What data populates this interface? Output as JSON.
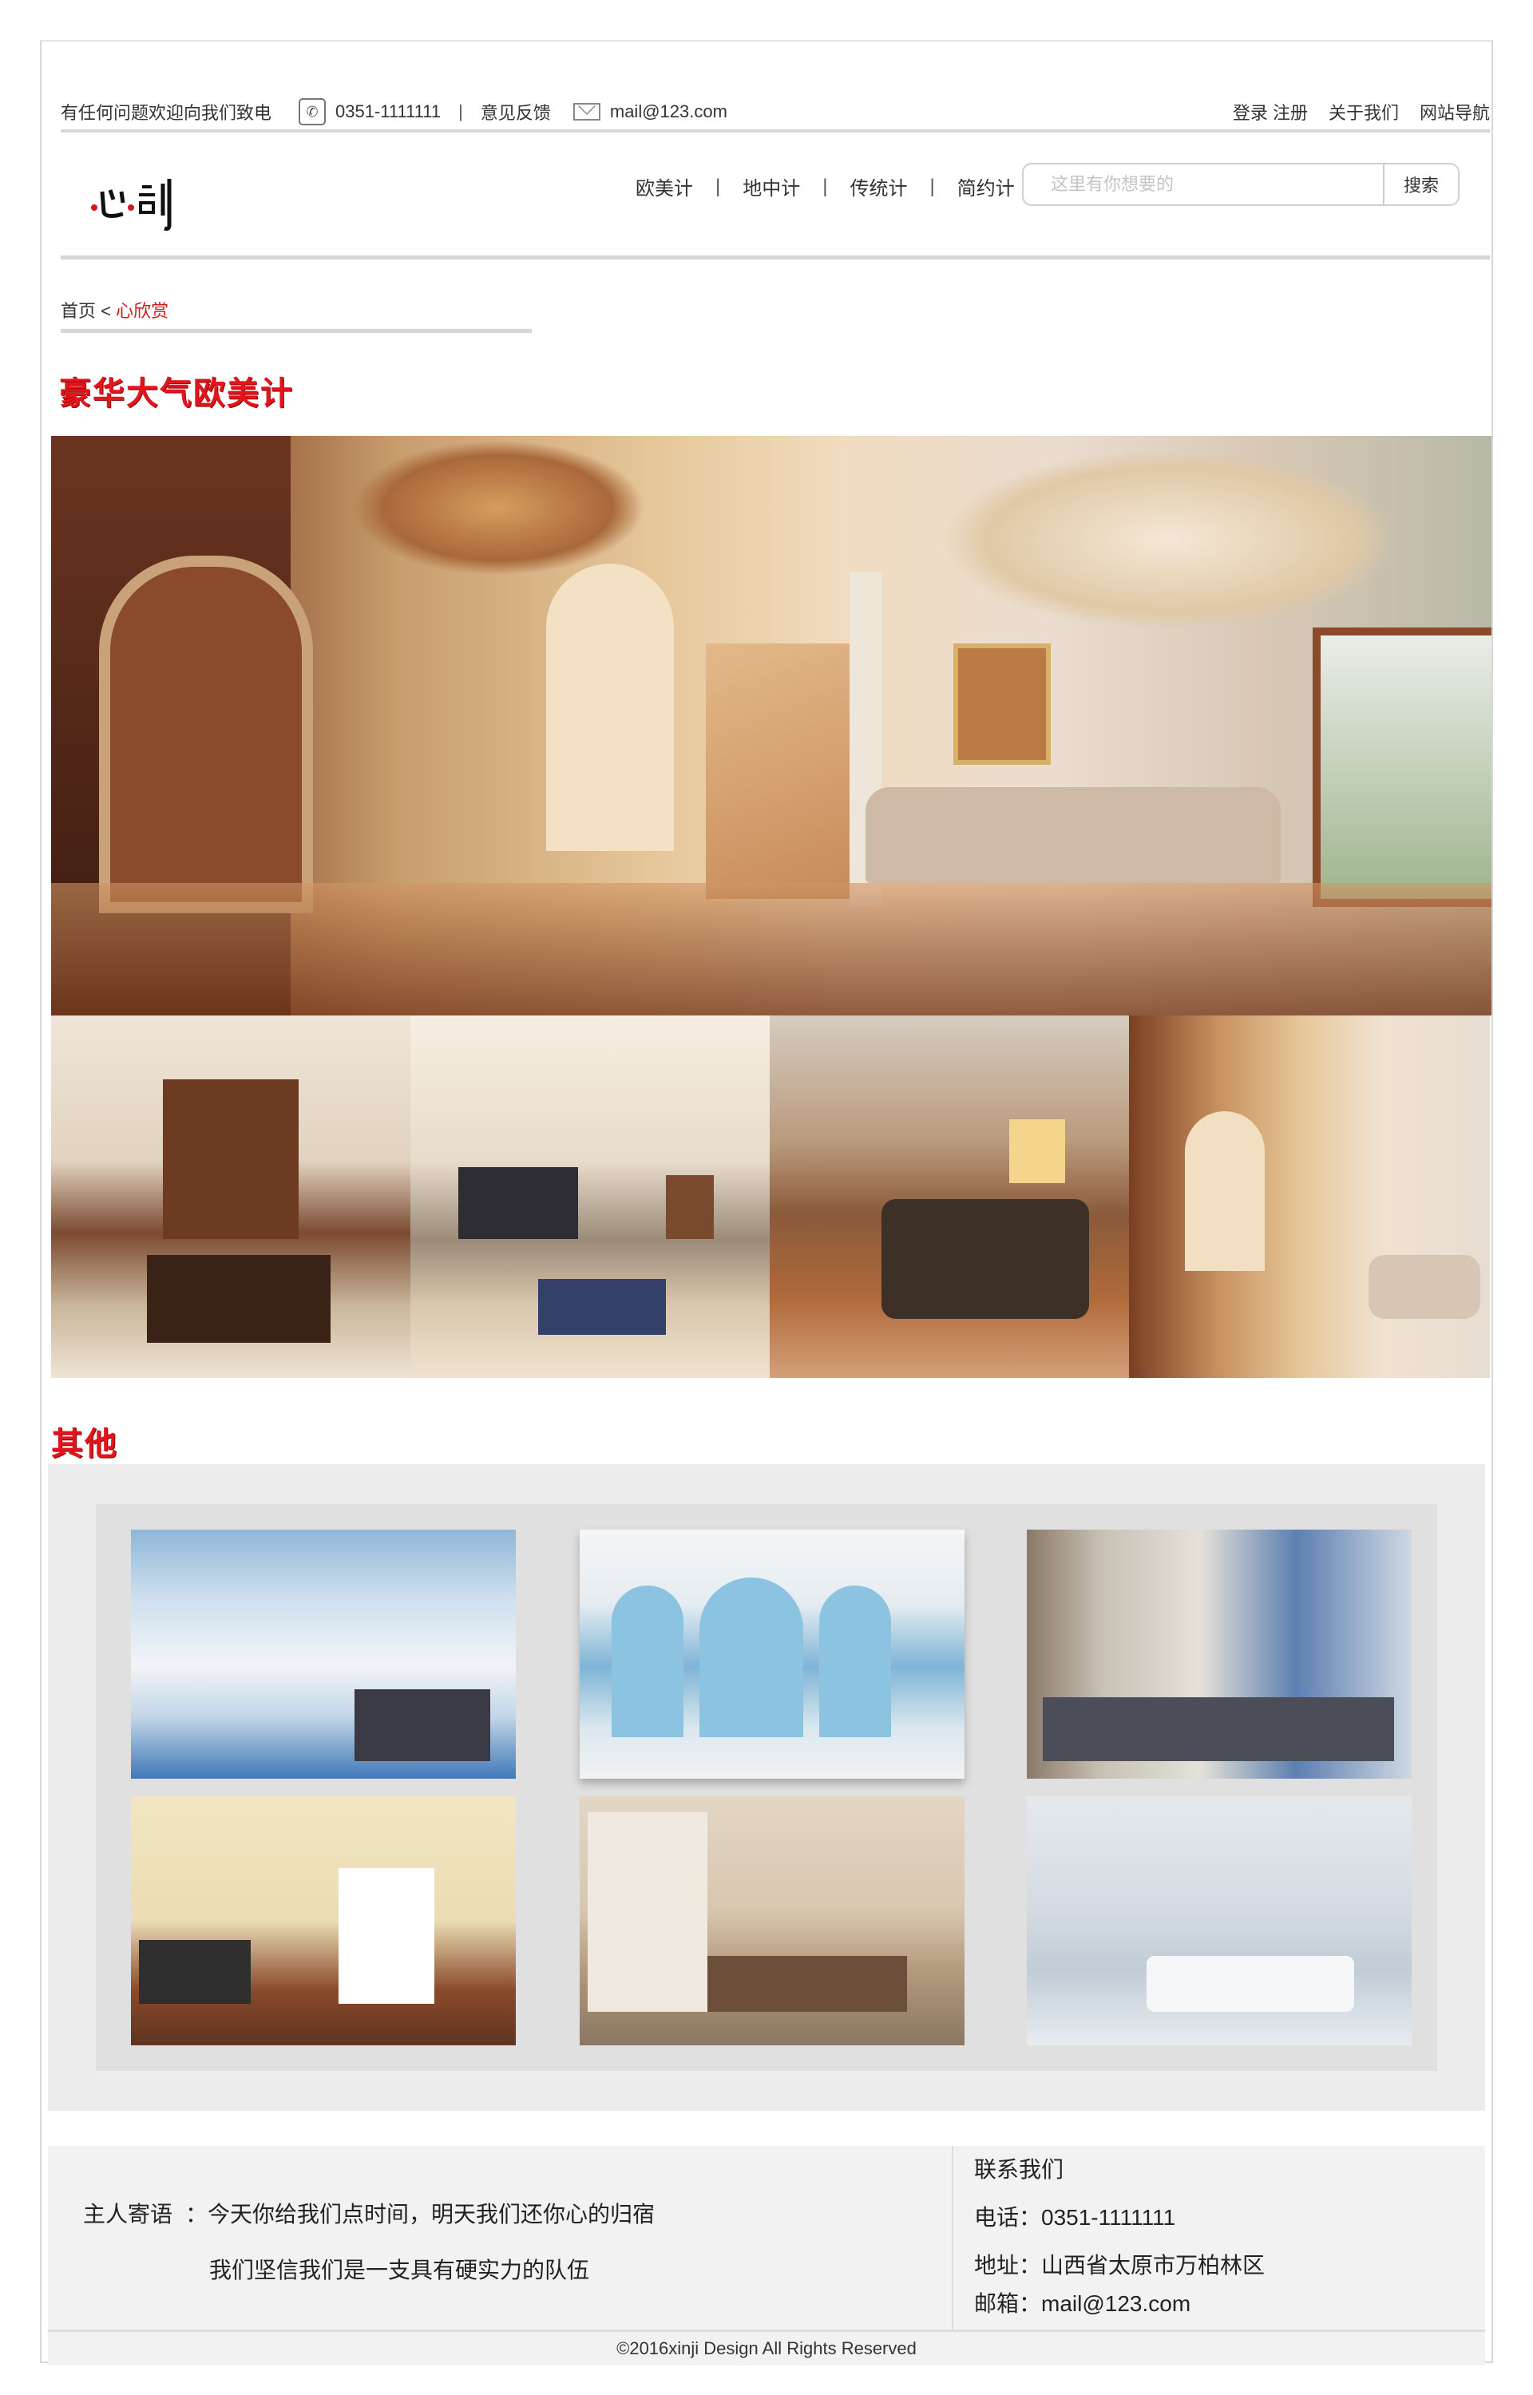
{
  "topbar": {
    "hotline_text": "有任何问题欢迎向我们致电",
    "phone": "0351-1111111",
    "separator": "|",
    "feedback": "意见反馈",
    "email": "mail@123.com",
    "login": "登录",
    "register": "注册",
    "about": "关于我们",
    "site_nav": "网站导航"
  },
  "header": {
    "logo_text": "心计",
    "nav": [
      "欧美计",
      "地中计",
      "传统计",
      "简约计"
    ],
    "nav_separator": "|",
    "search_placeholder": "这里有你想要的",
    "search_button": "搜索"
  },
  "breadcrumb": {
    "home": "首页",
    "separator": "<",
    "current": "心欣赏"
  },
  "featured": {
    "title": "豪华大气欧美计"
  },
  "other": {
    "title": "其他"
  },
  "footer": {
    "message_label": "主人寄语",
    "message_line1": "：今天你给我们点时间，明天我们还你心的归宿",
    "message_line2": "我们坚信我们是一支具有硬实力的队伍",
    "contact_title": "联系我们",
    "phone": "电话：0351-1111111",
    "address": "地址：山西省太原市万柏林区",
    "email": "邮箱：mail@123.com",
    "copyright": "©2016xinji Design All Rights Reserved"
  },
  "colors": {
    "accent_red": "#d0191b",
    "divider_gray": "#d6d6d6",
    "panel_gray": "#ececec"
  }
}
